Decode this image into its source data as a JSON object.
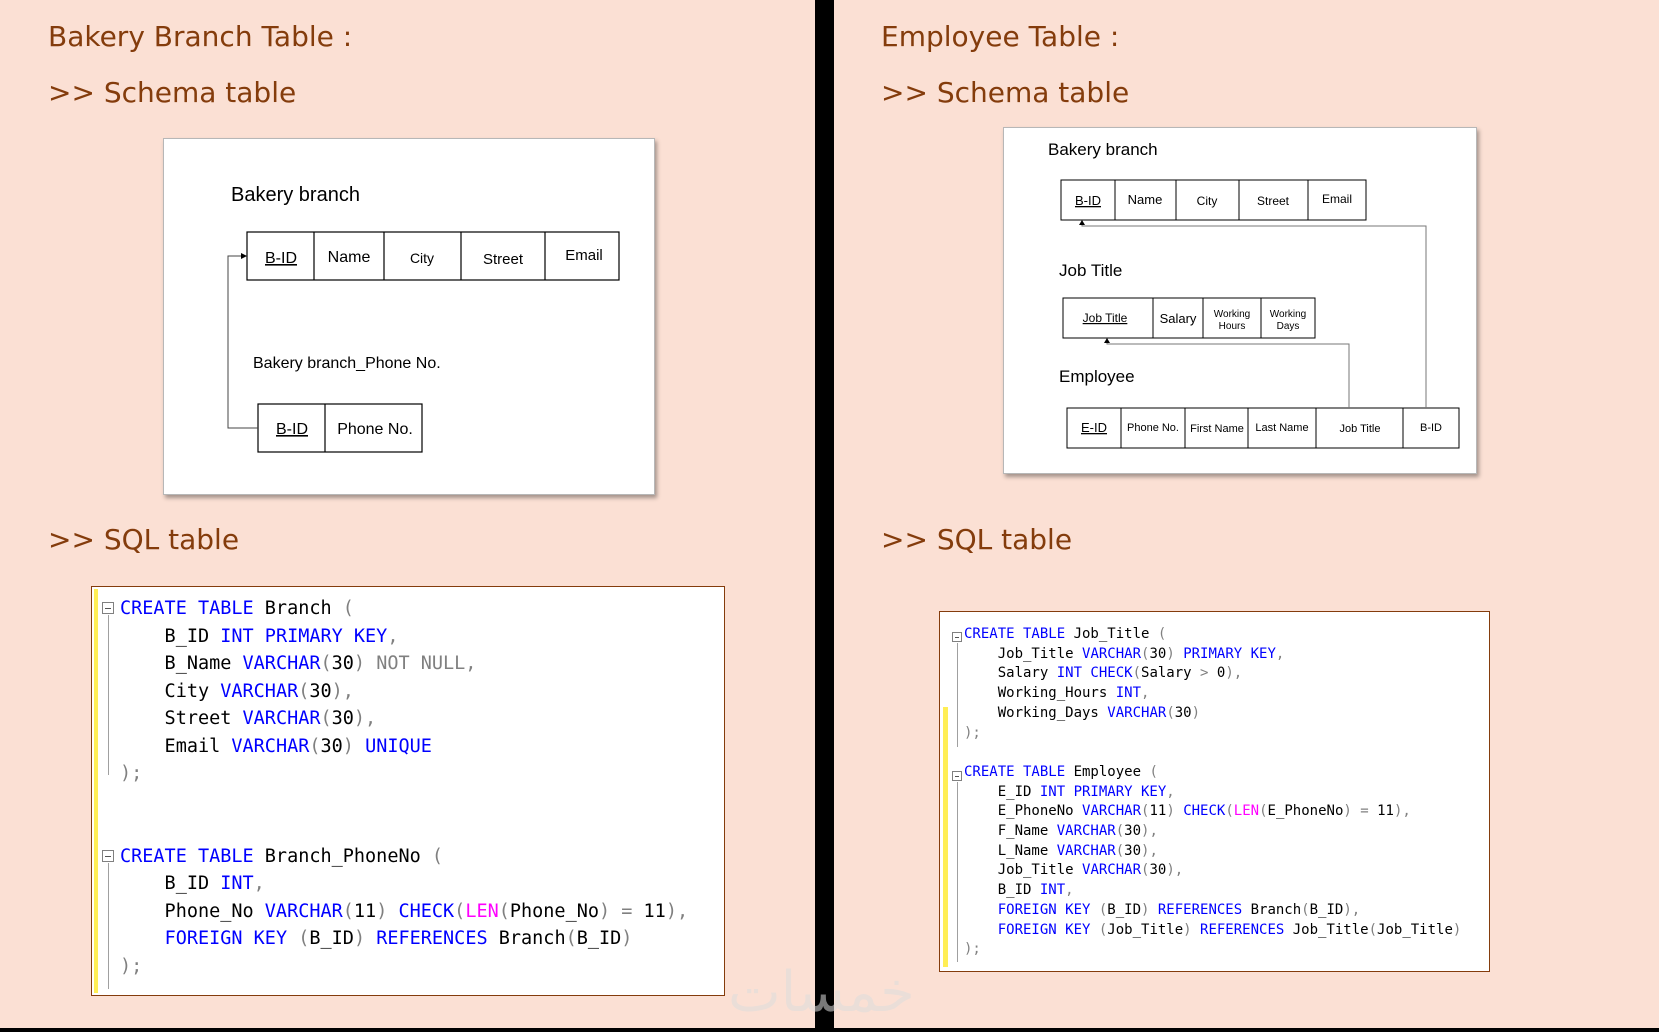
{
  "left": {
    "title": "Bakery Branch Table :",
    "schema_heading": ">> Schema table",
    "sql_heading": ">> SQL table",
    "schema": {
      "table1_name": "Bakery branch",
      "table1_cols": [
        "B-ID",
        "Name",
        "City",
        "Street",
        "Email"
      ],
      "table2_name": "Bakery branch_Phone No.",
      "table2_cols": [
        "B-ID",
        "Phone No."
      ]
    },
    "sql": {
      "lines": [
        [
          [
            "kw",
            "CREATE TABLE"
          ],
          [
            "",
            "Branch "
          ],
          [
            "gr",
            "("
          ]
        ],
        [
          [
            "",
            "    B_ID "
          ],
          [
            "kw",
            "INT PRIMARY KEY"
          ],
          [
            "gr",
            ","
          ]
        ],
        [
          [
            "",
            "    B_Name "
          ],
          [
            "kw",
            "VARCHAR"
          ],
          [
            "gr",
            "("
          ],
          [
            "",
            "30"
          ],
          [
            "gr",
            ") NOT NULL,"
          ]
        ],
        [
          [
            "",
            "    City "
          ],
          [
            "kw",
            "VARCHAR"
          ],
          [
            "gr",
            "("
          ],
          [
            "",
            "30"
          ],
          [
            "gr",
            "),"
          ]
        ],
        [
          [
            "",
            "    Street "
          ],
          [
            "kw",
            "VARCHAR"
          ],
          [
            "gr",
            "("
          ],
          [
            "",
            "30"
          ],
          [
            "gr",
            "),"
          ]
        ],
        [
          [
            "",
            "    Email "
          ],
          [
            "kw",
            "VARCHAR"
          ],
          [
            "gr",
            "("
          ],
          [
            "",
            "30"
          ],
          [
            "gr",
            ") "
          ],
          [
            "kw",
            "UNIQUE"
          ]
        ],
        [
          [
            "gr",
            ");"
          ]
        ],
        [
          [
            "",
            ""
          ]
        ],
        [
          [
            "",
            ""
          ]
        ],
        [
          [
            "kw",
            "CREATE TABLE"
          ],
          [
            "",
            "Branch_PhoneNo "
          ],
          [
            "gr",
            "("
          ]
        ],
        [
          [
            "",
            "    B_ID "
          ],
          [
            "kw",
            "INT"
          ],
          [
            "gr",
            ","
          ]
        ],
        [
          [
            "",
            "    Phone_No "
          ],
          [
            "kw",
            "VARCHAR"
          ],
          [
            "gr",
            "("
          ],
          [
            "",
            "11"
          ],
          [
            "gr",
            ") "
          ],
          [
            "kw",
            "CHECK"
          ],
          [
            "gr",
            "("
          ],
          [
            "fn",
            "LEN"
          ],
          [
            "gr",
            "("
          ],
          [
            "",
            "Phone_No"
          ],
          [
            "gr",
            ") = "
          ],
          [
            "",
            "11"
          ],
          [
            "gr",
            "),"
          ]
        ],
        [
          [
            "",
            "    "
          ],
          [
            "kw",
            "FOREIGN KEY"
          ],
          [
            "gr",
            " ("
          ],
          [
            "",
            "B_ID"
          ],
          [
            "gr",
            ") "
          ],
          [
            "kw",
            "REFERENCES"
          ],
          [
            "",
            "Branch"
          ],
          [
            "gr",
            "("
          ],
          [
            "",
            "B_ID"
          ],
          [
            "gr",
            ")"
          ]
        ],
        [
          [
            "gr",
            ");"
          ]
        ]
      ]
    }
  },
  "right": {
    "title": "Employee Table :",
    "schema_heading": ">> Schema table",
    "sql_heading": ">> SQL table",
    "schema": {
      "table1_name": "Bakery branch",
      "table1_cols": [
        "B-ID",
        "Name",
        "City",
        "Street",
        "Email"
      ],
      "table2_name": "Job Title",
      "table2_cols": [
        "Job Title",
        "Salary",
        "Working Hours",
        "Working Days"
      ],
      "table3_name": "Employee",
      "table3_cols": [
        "E-ID",
        "Phone No.",
        "First Name",
        "Last Name",
        "Job Title",
        "B-ID"
      ]
    },
    "sql": {
      "lines": [
        [
          [
            "kw",
            "CREATE TABLE"
          ],
          [
            "",
            "Job_Title "
          ],
          [
            "gr",
            "("
          ]
        ],
        [
          [
            "",
            "    Job_Title "
          ],
          [
            "kw",
            "VARCHAR"
          ],
          [
            "gr",
            "("
          ],
          [
            "",
            "30"
          ],
          [
            "gr",
            ") "
          ],
          [
            "kw",
            "PRIMARY KEY"
          ],
          [
            "gr",
            ","
          ]
        ],
        [
          [
            "",
            "    Salary "
          ],
          [
            "kw",
            "INT CHECK"
          ],
          [
            "gr",
            "("
          ],
          [
            "",
            "Salary "
          ],
          [
            "gr",
            "> "
          ],
          [
            "",
            "0"
          ],
          [
            "gr",
            "),"
          ]
        ],
        [
          [
            "",
            "    Working_Hours "
          ],
          [
            "kw",
            "INT"
          ],
          [
            "gr",
            ","
          ]
        ],
        [
          [
            "",
            "    Working_Days "
          ],
          [
            "kw",
            "VARCHAR"
          ],
          [
            "gr",
            "("
          ],
          [
            "",
            "30"
          ],
          [
            "gr",
            ")"
          ]
        ],
        [
          [
            "gr",
            ");"
          ]
        ],
        [
          [
            "",
            ""
          ]
        ],
        [
          [
            "kw",
            "CREATE TABLE"
          ],
          [
            "",
            "Employee "
          ],
          [
            "gr",
            "("
          ]
        ],
        [
          [
            "",
            "    E_ID "
          ],
          [
            "kw",
            "INT PRIMARY KEY"
          ],
          [
            "gr",
            ","
          ]
        ],
        [
          [
            "",
            "    E_PhoneNo "
          ],
          [
            "kw",
            "VARCHAR"
          ],
          [
            "gr",
            "("
          ],
          [
            "",
            "11"
          ],
          [
            "gr",
            ") "
          ],
          [
            "kw",
            "CHECK"
          ],
          [
            "gr",
            "("
          ],
          [
            "fn",
            "LEN"
          ],
          [
            "gr",
            "("
          ],
          [
            "",
            "E_PhoneNo"
          ],
          [
            "gr",
            ") = "
          ],
          [
            "",
            "11"
          ],
          [
            "gr",
            "),"
          ]
        ],
        [
          [
            "",
            "    F_Name "
          ],
          [
            "kw",
            "VARCHAR"
          ],
          [
            "gr",
            "("
          ],
          [
            "",
            "30"
          ],
          [
            "gr",
            "),"
          ]
        ],
        [
          [
            "",
            "    L_Name "
          ],
          [
            "kw",
            "VARCHAR"
          ],
          [
            "gr",
            "("
          ],
          [
            "",
            "30"
          ],
          [
            "gr",
            "),"
          ]
        ],
        [
          [
            "",
            "    Job_Title "
          ],
          [
            "kw",
            "VARCHAR"
          ],
          [
            "gr",
            "("
          ],
          [
            "",
            "30"
          ],
          [
            "gr",
            "),"
          ]
        ],
        [
          [
            "",
            "    B_ID "
          ],
          [
            "kw",
            "INT"
          ],
          [
            "gr",
            ","
          ]
        ],
        [
          [
            "",
            "    "
          ],
          [
            "kw",
            "FOREIGN KEY"
          ],
          [
            "gr",
            " ("
          ],
          [
            "",
            "B_ID"
          ],
          [
            "gr",
            ") "
          ],
          [
            "kw",
            "REFERENCES"
          ],
          [
            "",
            "Branch"
          ],
          [
            "gr",
            "("
          ],
          [
            "",
            "B_ID"
          ],
          [
            "gr",
            "),"
          ]
        ],
        [
          [
            "",
            "    "
          ],
          [
            "kw",
            "FOREIGN KEY"
          ],
          [
            "gr",
            " ("
          ],
          [
            "",
            "Job_Title"
          ],
          [
            "gr",
            ") "
          ],
          [
            "kw",
            "REFERENCES"
          ],
          [
            "",
            "Job_Title"
          ],
          [
            "gr",
            "("
          ],
          [
            "",
            "Job_Title"
          ],
          [
            "gr",
            ")"
          ]
        ],
        [
          [
            "gr",
            ");"
          ]
        ]
      ]
    }
  },
  "watermark": "خمسات"
}
